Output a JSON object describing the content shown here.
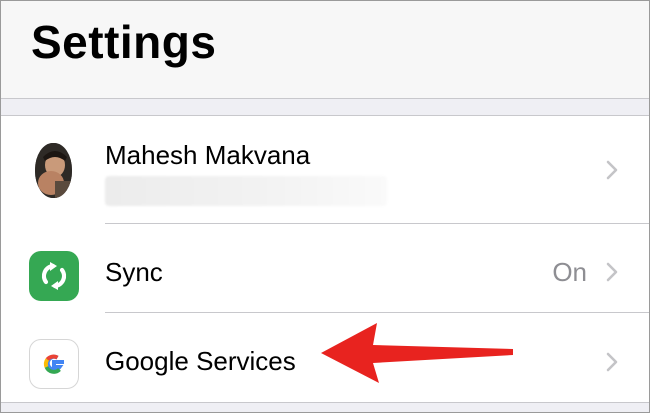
{
  "header": {
    "title": "Settings"
  },
  "profile": {
    "name": "Mahesh Makvana",
    "icon": "profile-avatar"
  },
  "items": [
    {
      "label": "Sync",
      "value": "On",
      "icon": "sync-icon",
      "icon_color": "#35a853"
    },
    {
      "label": "Google Services",
      "icon": "google-g-icon"
    }
  ],
  "annotation": {
    "icon": "red-arrow",
    "color": "#e8231f"
  }
}
